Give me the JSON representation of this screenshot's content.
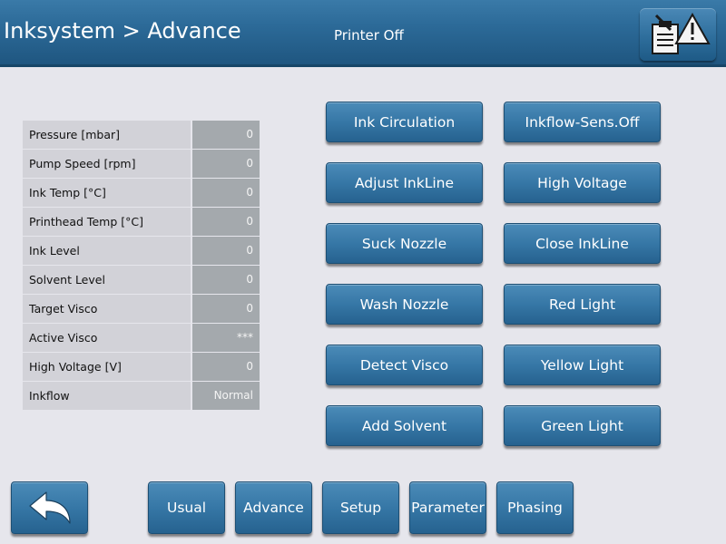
{
  "header": {
    "title": "Inksystem > Advance",
    "status": "Printer Off",
    "alarm_icon": "clipboard-warning-icon"
  },
  "table": {
    "rows": [
      {
        "label": "Pressure [mbar]",
        "value": "0"
      },
      {
        "label": "Pump Speed [rpm]",
        "value": "0"
      },
      {
        "label": "Ink Temp [°C]",
        "value": "0"
      },
      {
        "label": "Printhead Temp [°C]",
        "value": "0"
      },
      {
        "label": "Ink Level",
        "value": "0"
      },
      {
        "label": "Solvent Level",
        "value": "0"
      },
      {
        "label": "Target Visco",
        "value": "0"
      },
      {
        "label": "Active Visco",
        "value": "***"
      },
      {
        "label": "High Voltage [V]",
        "value": "0"
      },
      {
        "label": "Inkflow",
        "value": "Normal"
      }
    ]
  },
  "actions": {
    "ink_circulation": "Ink Circulation",
    "inkflow_sens_off": "Inkflow-Sens.Off",
    "adjust_inkline": "Adjust InkLine",
    "high_voltage": "High Voltage",
    "suck_nozzle": "Suck Nozzle",
    "close_inkline": "Close InkLine",
    "wash_nozzle": "Wash Nozzle",
    "red_light": "Red Light",
    "detect_visco": "Detect Visco",
    "yellow_light": "Yellow Light",
    "add_solvent": "Add Solvent",
    "green_light": "Green Light"
  },
  "nav": {
    "back_icon": "back-arrow-icon",
    "usual": "Usual",
    "advance": "Advance",
    "setup": "Setup",
    "parameter": "Parameter",
    "phasing": "Phasing"
  },
  "colors": {
    "header": "#2c6a98",
    "button": "#3677a6",
    "background": "#e6e6ec",
    "label_cell": "#d2d2d8",
    "value_cell": "#a4a9ad"
  }
}
